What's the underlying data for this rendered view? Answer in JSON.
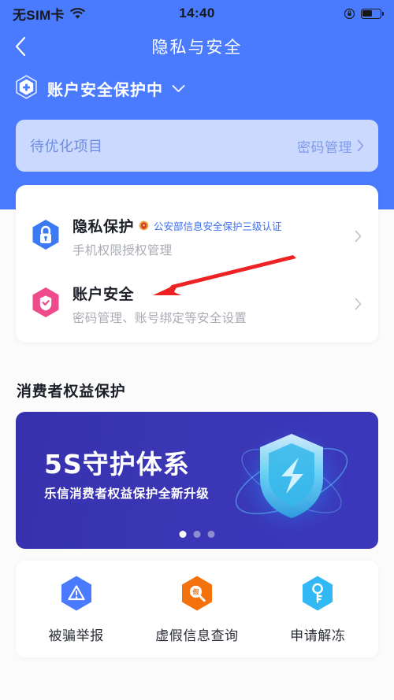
{
  "status_bar": {
    "carrier": "无SIM卡",
    "wifi_icon": "wifi-icon",
    "time": "14:40",
    "rotation_lock_icon": "rotation-lock-icon",
    "battery_icon": "battery-icon",
    "battery_level_pct": 55
  },
  "nav": {
    "back_icon": "chevron-left-icon",
    "title": "隐私与安全"
  },
  "account_status": {
    "shield_icon": "shield-plus-icon",
    "label": "账户安全保护中",
    "expand_icon": "chevron-down-icon"
  },
  "pending_card": {
    "label": "待优化项目",
    "action_label": "密码管理",
    "chevron_icon": "chevron-right-icon"
  },
  "security_rows": [
    {
      "icon": "hexagon-lock-icon",
      "title": "隐私保护",
      "cert_badge_icon": "police-emblem-icon",
      "cert_text": "公安部信息安全保护三级认证",
      "subtitle": "手机权限授权管理",
      "chevron_icon": "chevron-right-icon"
    },
    {
      "icon": "hexagon-shield-check-icon",
      "title": "账户安全",
      "cert_badge_icon": "",
      "cert_text": "",
      "subtitle": "密码管理、账号绑定等安全设置",
      "chevron_icon": "chevron-right-icon"
    }
  ],
  "consumer_section": {
    "title": "消费者权益保护",
    "banner": {
      "headline": "5S守护体系",
      "subline": "乐信消费者权益保护全新升级",
      "art_icon": "glowing-shield-icon",
      "dots_total": 3,
      "dots_active_index": 0
    }
  },
  "quick_actions": [
    {
      "icon": "warning-triangle-icon",
      "label": "被骗举报",
      "color": "#4a7afd"
    },
    {
      "icon": "fake-info-search-icon",
      "label": "虚假信息查询",
      "color": "#f4720d"
    },
    {
      "icon": "key-icon",
      "label": "申请解冻",
      "color": "#32b9f5"
    }
  ],
  "annotation": {
    "arrow_icon": "red-arrow-icon",
    "color": "#ee2222"
  },
  "theme": {
    "header_blue": "#4a7afd",
    "pending_card_bg": "#ccd9fe",
    "page_bg": "#fbfbfc",
    "banner_blue": "#3a36b4"
  }
}
